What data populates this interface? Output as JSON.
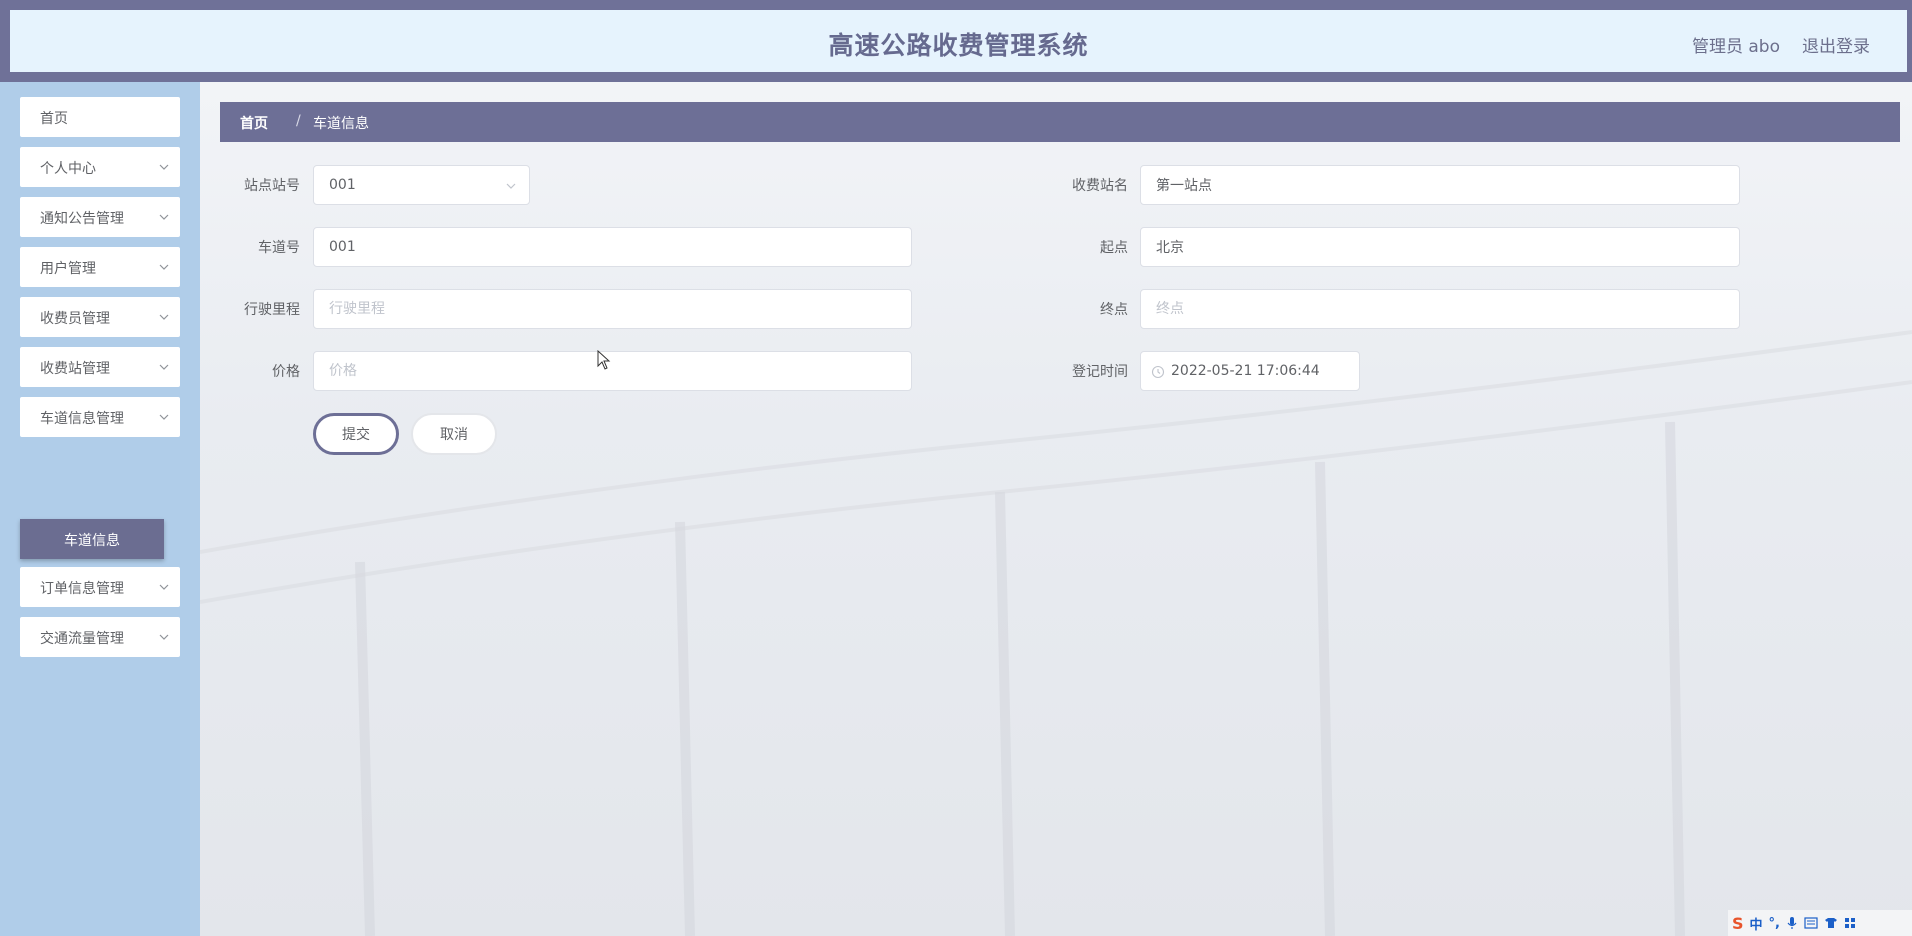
{
  "header": {
    "title": "高速公路收费管理系统",
    "admin_label": "管理员 abo",
    "logout": "退出登录"
  },
  "sidebar": {
    "items": [
      {
        "label": "首页"
      },
      {
        "label": "个人中心"
      },
      {
        "label": "通知公告管理"
      },
      {
        "label": "用户管理"
      },
      {
        "label": "收费员管理"
      },
      {
        "label": "收费站管理"
      },
      {
        "label": "车道信息管理"
      },
      {
        "label": "订单信息管理"
      },
      {
        "label": "交通流量管理"
      }
    ],
    "active_sub": "车道信息"
  },
  "breadcrumb": {
    "home": "首页",
    "separator": "/",
    "current": "车道信息"
  },
  "form": {
    "station_no": {
      "label": "站点站号",
      "value": "001"
    },
    "station_name": {
      "label": "收费站名",
      "value": "第一站点"
    },
    "lane_no": {
      "label": "车道号",
      "value": "001"
    },
    "start": {
      "label": "起点",
      "value": "北京"
    },
    "mileage": {
      "label": "行驶里程",
      "placeholder": "行驶里程"
    },
    "end": {
      "label": "终点",
      "placeholder": "终点"
    },
    "price": {
      "label": "价格",
      "placeholder": "价格"
    },
    "reg_time": {
      "label": "登记时间",
      "value": "2022-05-21 17:06:44"
    },
    "submit": "提交",
    "cancel": "取消"
  },
  "ime": {
    "logo": "S",
    "mode": "中",
    "punct": "°,"
  },
  "colors": {
    "accent": "#6d6f96",
    "sidebar_bg": "#b0cde9",
    "header_bg": "#e6f3fd"
  }
}
